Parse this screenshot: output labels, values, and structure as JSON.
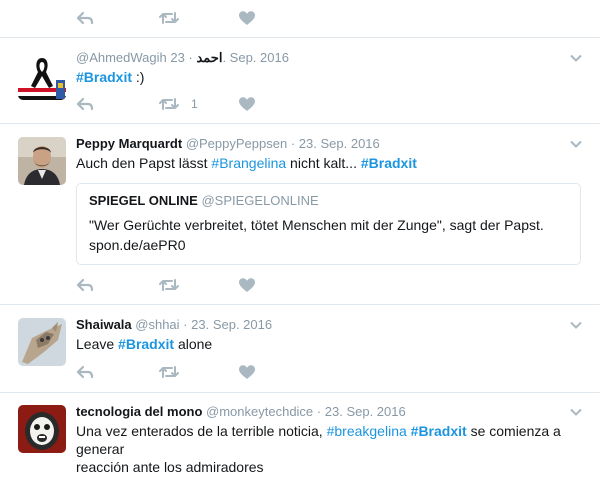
{
  "tweets": [
    {
      "id_label": "top",
      "reply_count": "",
      "retweet_count": "",
      "like_count": ""
    },
    {
      "fullname": "",
      "handle": "@AhmedWagih",
      "handle_arabic": "احمد",
      "date": "23. Sep. 2016",
      "text_parts": [
        "#Bradxit",
        " :)"
      ],
      "retweet_count": "1"
    },
    {
      "fullname": "Peppy Marquardt",
      "handle": "@PeppyPeppsen",
      "date": "23. Sep. 2016",
      "text_parts": [
        "Auch den Papst lässt ",
        "#Brangelina",
        " nicht kalt... ",
        "#Bradxit"
      ],
      "quote": {
        "fullname": "SPIEGEL ONLINE",
        "handle": "@SPIEGELONLINE",
        "text": "\"Wer Gerüchte verbreitet, tötet Menschen mit der Zunge\", sagt der Papst.",
        "link": "spon.de/aePR0"
      }
    },
    {
      "fullname": "Shaiwala",
      "handle": "@shhai",
      "date": "23. Sep. 2016",
      "text_parts": [
        "Leave ",
        "#Bradxit",
        " alone"
      ]
    },
    {
      "fullname": "tecnologia del mono",
      "handle": "@monkeytechdice",
      "date": "23. Sep. 2016",
      "text_line1": [
        "Una vez enterados de la terrible noticia, ",
        "#breakgelina",
        " ",
        "#Bradxit",
        " se comienza a"
      ],
      "text_line2": "generar",
      "text_line3": "reacción ante los admiradores"
    }
  ],
  "separator": "·",
  "colors": {
    "link": "#1b95e0",
    "muted": "#8899a6",
    "border": "#e1e8ed",
    "text": "#14171a"
  },
  "icons": [
    "reply-icon",
    "retweet-icon",
    "like-icon",
    "caret-down-icon"
  ]
}
